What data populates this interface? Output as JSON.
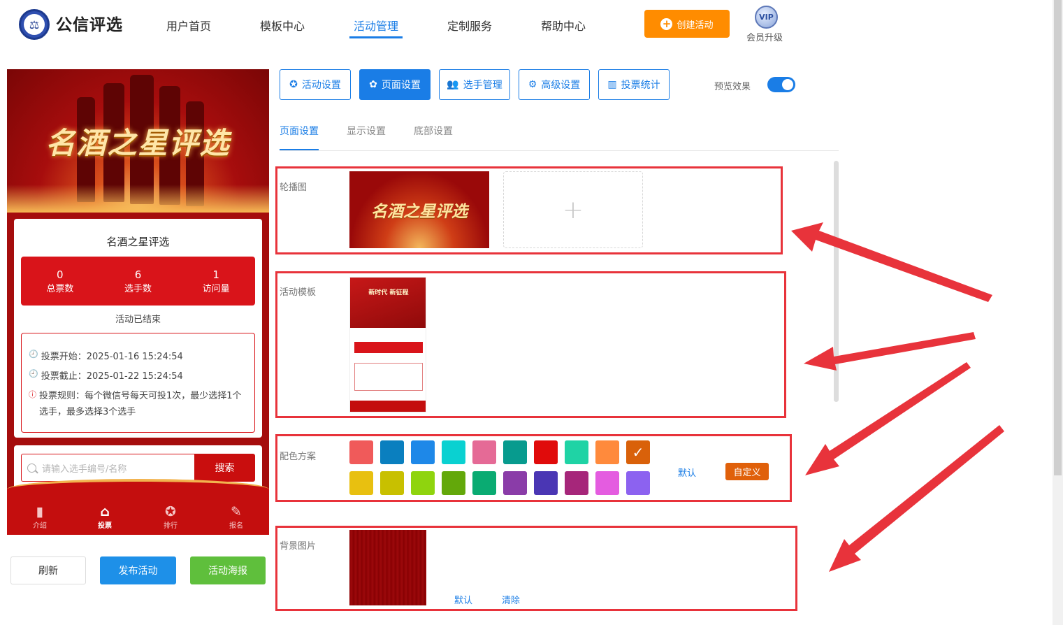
{
  "brand": {
    "name": "公信评选",
    "logo_icon": "scales-icon"
  },
  "nav": {
    "items": [
      {
        "label": "用户首页"
      },
      {
        "label": "模板中心"
      },
      {
        "label": "活动管理",
        "active": true
      },
      {
        "label": "定制服务"
      },
      {
        "label": "帮助中心"
      }
    ],
    "create_label": "创建活动",
    "vip_badge": "VIP",
    "vip_label": "会员升级"
  },
  "preview": {
    "banner_title": "名酒之星评选",
    "card_title": "名酒之星评选",
    "stats": [
      {
        "value": "0",
        "label": "总票数"
      },
      {
        "value": "6",
        "label": "选手数"
      },
      {
        "value": "1",
        "label": "访问量"
      }
    ],
    "status": "活动已结束",
    "vote_start": "投票开始：2025-01-16 15:24:54",
    "vote_end": "投票截止：2025-01-22 15:24:54",
    "vote_rule": "投票规则：每个微信号每天可投1次，最少选择1个选手，最多选择3个选手",
    "search_placeholder": "请输入选手编号/名称",
    "search_button": "搜索",
    "tabs": [
      {
        "label": "介绍",
        "icon": "book-icon"
      },
      {
        "label": "投票",
        "icon": "home-icon",
        "active": true
      },
      {
        "label": "排行",
        "icon": "medal-icon"
      },
      {
        "label": "报名",
        "icon": "edit-icon"
      }
    ]
  },
  "actions": {
    "refresh": "刷新",
    "publish": "发布活动",
    "poster": "活动海报"
  },
  "settings_tabs": [
    {
      "label": "活动设置",
      "icon": "star-icon"
    },
    {
      "label": "页面设置",
      "icon": "gear-icon",
      "active": true
    },
    {
      "label": "选手管理",
      "icon": "users-icon"
    },
    {
      "label": "高级设置",
      "icon": "settings-icon"
    },
    {
      "label": "投票统计",
      "icon": "bar-chart-icon"
    }
  ],
  "preview_toggle": {
    "label": "预览效果",
    "on": true
  },
  "sub_tabs": [
    {
      "label": "页面设置",
      "active": true
    },
    {
      "label": "显示设置"
    },
    {
      "label": "底部设置"
    }
  ],
  "sections": {
    "carousel": {
      "label": "轮播图",
      "image_text": "名酒之星评选"
    },
    "template": {
      "label": "活动模板",
      "thumb_title": "新时代 新征程"
    },
    "colors": {
      "label": "配色方案",
      "swatches": [
        "#f05a5a",
        "#0a7fbf",
        "#1e88e8",
        "#0ad1d1",
        "#e56a96",
        "#079b8e",
        "#e00b0b",
        "#1fd3a5",
        "#ff8a3c",
        "#d9610a",
        "#e8c010",
        "#c8c000",
        "#8fd40e",
        "#63a80a",
        "#0aab72",
        "#8a3ca8",
        "#4a36b4",
        "#a6267a",
        "#e45ce0",
        "#8c62f0"
      ],
      "selected_index": 9,
      "default_label": "默认",
      "custom_label": "自定义"
    },
    "background": {
      "label": "背景图片",
      "default_label": "默认",
      "clear_label": "清除"
    }
  }
}
